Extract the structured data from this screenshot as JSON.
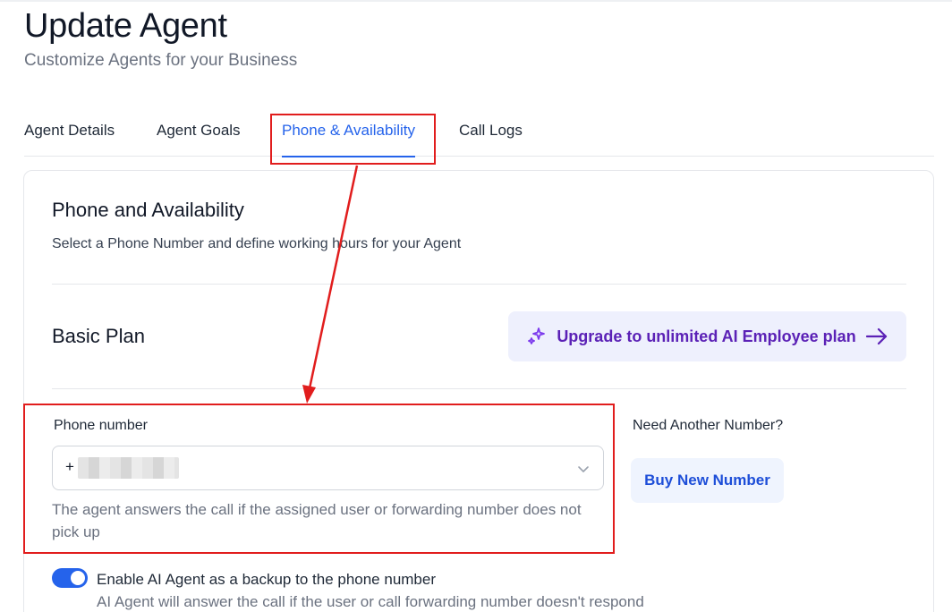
{
  "header": {
    "title": "Update Agent",
    "subtitle": "Customize Agents for your Business"
  },
  "tabs": [
    {
      "label": "Agent Details",
      "active": false
    },
    {
      "label": "Agent Goals",
      "active": false
    },
    {
      "label": "Phone & Availability",
      "active": true
    },
    {
      "label": "Call Logs",
      "active": false
    }
  ],
  "section": {
    "title": "Phone and Availability",
    "description": "Select a Phone Number and define working hours for your Agent"
  },
  "plan": {
    "title": "Basic Plan",
    "upgrade_label": "Upgrade to unlimited AI Employee plan",
    "upgrade_icon": "sparkles-icon"
  },
  "phone": {
    "label": "Phone number",
    "value_prefix": "+",
    "helper": "The agent answers the call if the assigned user or forwarding number does not pick up"
  },
  "another": {
    "label": "Need Another Number?",
    "buy_label": "Buy New Number"
  },
  "backup": {
    "label": "Enable AI Agent as a backup to the phone number",
    "description": "AI Agent will answer the call if the user or call forwarding number doesn't respond",
    "enabled": true
  },
  "colors": {
    "accent": "#2563eb",
    "upgrade_text": "#5b21b6",
    "annotation": "#e11d1d"
  }
}
